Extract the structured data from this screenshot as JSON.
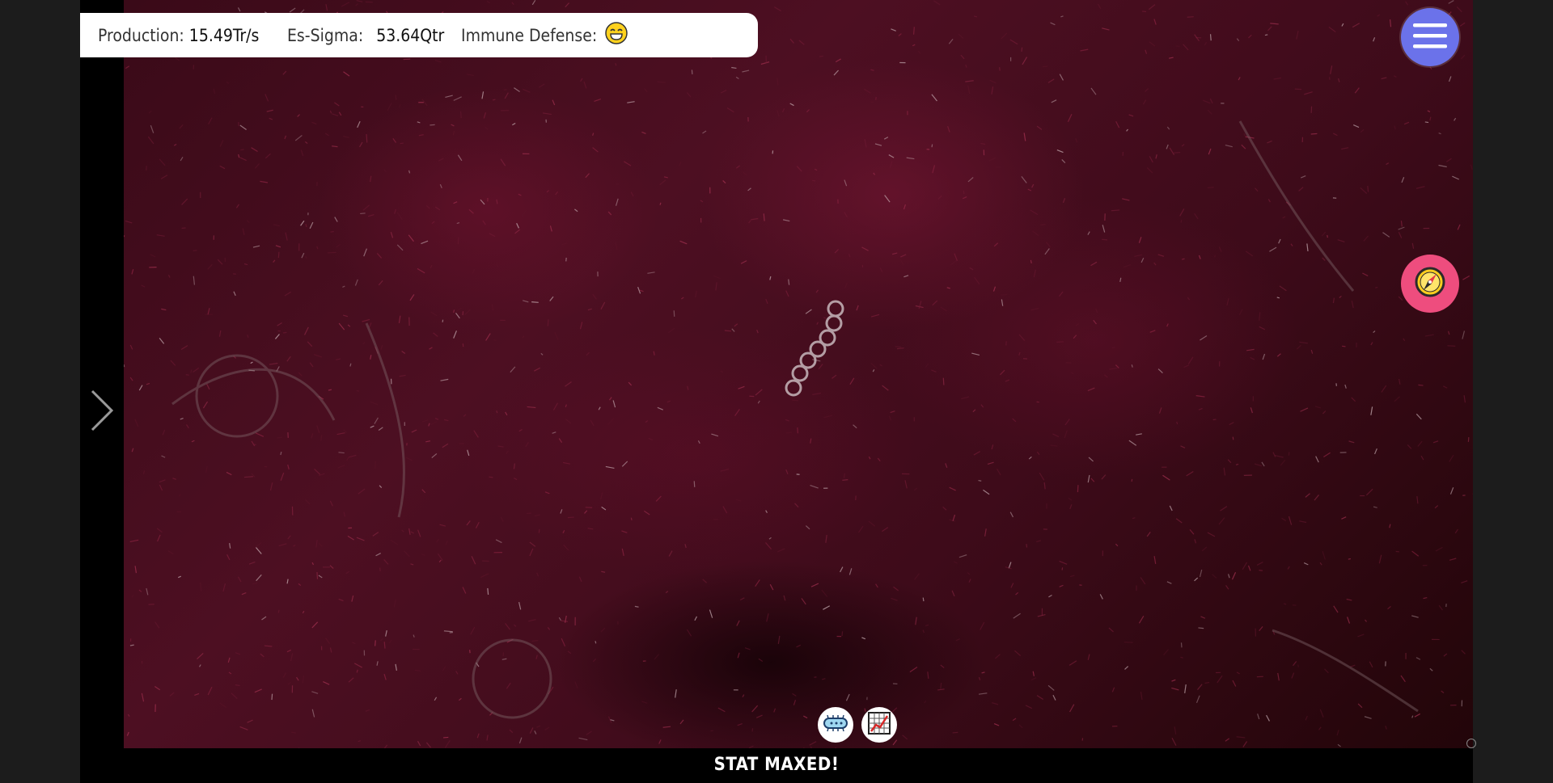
{
  "hud": {
    "production_label": "Production:",
    "production_value": "15.49Tr/s",
    "essigma_label": "Es-Sigma:",
    "essigma_value": "53.64Qtr",
    "immune_label": "Immune Defense:",
    "immune_icon": "laughing-face-icon"
  },
  "buttons": {
    "menu_icon": "hamburger-menu-icon",
    "compass_icon": "compass-icon",
    "side_nav_icon": "chevron-right-icon",
    "bottom_left_icon": "bacteria-icon",
    "bottom_right_icon": "stats-chart-icon"
  },
  "status": {
    "text": "STAT MAXED!"
  },
  "colors": {
    "menu_button": "#6b72ea",
    "compass_button": "#ee4d7e",
    "canvas_base": "#4d0f22",
    "emoji_face": "#ffd21e"
  }
}
